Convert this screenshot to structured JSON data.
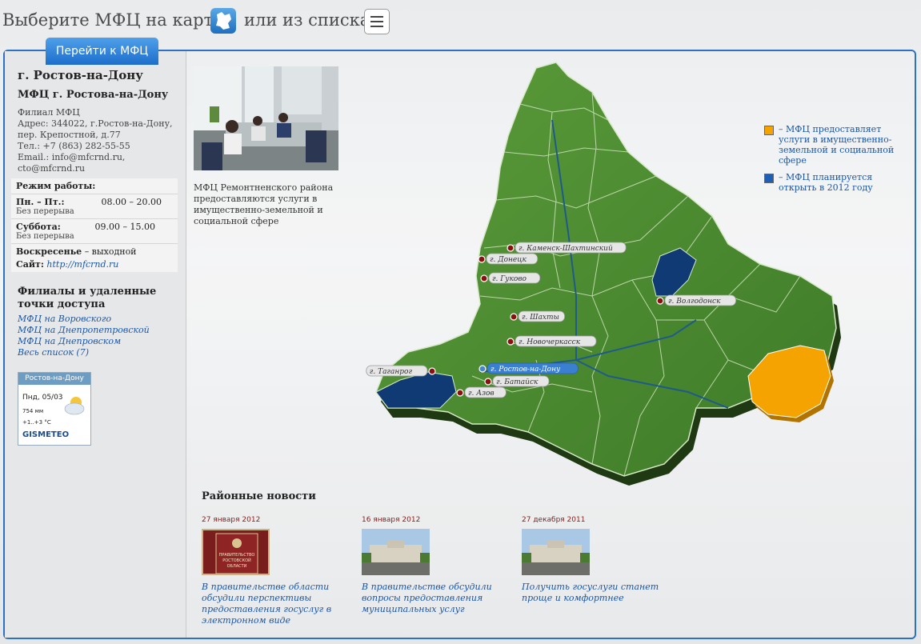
{
  "header": {
    "title_part1": "Выберите МФЦ на карте",
    "title_part2": "или из списка",
    "go_button": "Перейти к МФЦ"
  },
  "sidebar": {
    "city": "г. Ростов-на-Дону",
    "org": "МФЦ г. Ростова-на-Дону",
    "address_lines": [
      "Филиал МФЦ",
      "Адрес: 344022, г.Ростов-на-Дону,",
      "пер. Крепостной, д.77",
      "Тел.: +7 (863) 282-55-55",
      "Email.: info@mfcrnd.ru,",
      "cto@mfcrnd.ru"
    ],
    "schedule_title": "Режим работы:",
    "weekdays_label": "Пн. – Пт.:",
    "weekdays_time": "08.00 – 20.00",
    "weekdays_note": "Без перерыва",
    "saturday_label": "Суббота:",
    "saturday_time": "09.00 – 15.00",
    "saturday_note": "Без перерыва",
    "sunday_label": "Воскресенье",
    "sunday_note": "– выходной",
    "site_label": "Сайт:",
    "site_url": "http://mfcrnd.ru",
    "branches_title": "Филиалы и удаленные точки доступа",
    "branches": [
      "МФЦ на Воровского",
      "МФЦ на Днепропетровской",
      "МФЦ на Днепровском",
      "Весь список (7)"
    ],
    "weather": {
      "city": "Ростов-на-Дону",
      "day": "Пнд, 05/03",
      "pressure": "754 мм",
      "temp": "+1..+3 °C",
      "brand": "GISMETEO"
    }
  },
  "photo_caption": "МФЦ Ремонтненского района предоставляются услуги в имущественно-земельной и социальной сфере",
  "legend": [
    {
      "color": "#f5a300",
      "text": "– МФЦ предоставляет услуги в имущественно-земельной и социальной сфере"
    },
    {
      "color": "#1e5fb5",
      "text": "– МФЦ планируется открыть в 2012 году"
    }
  ],
  "map": {
    "cities": [
      {
        "name": "г. Каменск-Шахтинский",
        "active": false
      },
      {
        "name": "г. Донецк",
        "active": false
      },
      {
        "name": "г. Гуково",
        "active": false
      },
      {
        "name": "г. Волгодонск",
        "active": false
      },
      {
        "name": "г. Шахты",
        "active": false
      },
      {
        "name": "г. Новочеркасск",
        "active": false
      },
      {
        "name": "г. Таганрог",
        "active": false
      },
      {
        "name": "г. Ростов-на-Дону",
        "active": true
      },
      {
        "name": "г. Батайск",
        "active": false
      },
      {
        "name": "г. Азов",
        "active": false
      }
    ]
  },
  "news_title": "Районные новости",
  "news": [
    {
      "date": "27 января 2012",
      "text": "В правительстве области обсудили перспективы предоставления госуслуг в электронном виде",
      "thumb_text": "ПРАВИТЕЛЬСТВО РОСТОВСКОЙ ОБЛАСТИ"
    },
    {
      "date": "16 января 2012",
      "text": "В правительстве обсудили вопросы предоставления муниципальных услуг",
      "thumb_text": ""
    },
    {
      "date": "27 декабря 2011",
      "text": "Получить госуслуги станет проще и комфортнее",
      "thumb_text": ""
    }
  ]
}
